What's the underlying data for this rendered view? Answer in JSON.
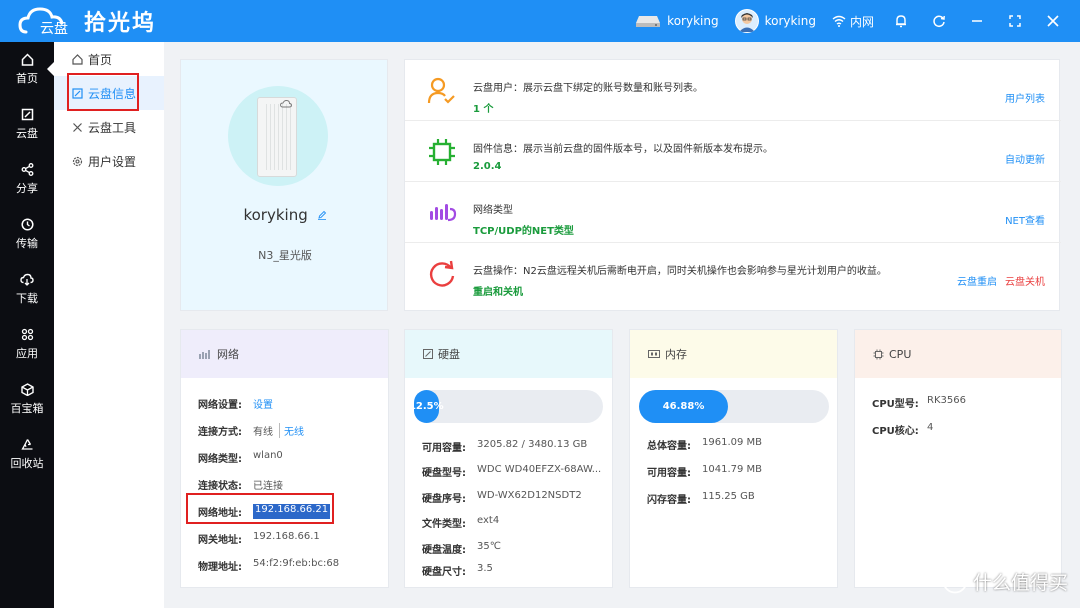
{
  "app": {
    "title": "拾光坞"
  },
  "topbar": {
    "device_name": "koryking",
    "user_name": "koryking",
    "network_label": "内网"
  },
  "leftnav": {
    "items": [
      "首页",
      "云盘",
      "分享",
      "传输",
      "下载",
      "应用",
      "百宝箱",
      "回收站"
    ]
  },
  "subnav": {
    "items": [
      "首页",
      "云盘信息",
      "云盘工具",
      "用户设置"
    ]
  },
  "profile": {
    "username": "koryking",
    "model": "N3_星光版"
  },
  "info": {
    "user": {
      "desc": "云盘用户：展示云盘下绑定的账号数量和账号列表。",
      "value": "1 个",
      "action": "用户列表"
    },
    "firmware": {
      "desc": "固件信息：展示当前云盘的固件版本号，以及固件新版本发布提示。",
      "value": "2.0.4",
      "action": "自动更新"
    },
    "net": {
      "desc": "网络类型",
      "value": "TCP/UDP的NET类型",
      "action": "NET查看"
    },
    "ops": {
      "desc": "云盘操作：N2云盘远程关机后需断电开启，同时关机操作也会影响参与星光计划用户的收益。",
      "value": "重启和关机",
      "action_restart": "云盘重启",
      "action_shutdown": "云盘关机"
    }
  },
  "network": {
    "title": "网络",
    "rows": [
      {
        "k": "网络设置:",
        "v": "设置"
      },
      {
        "k": "连接方式:",
        "v": "有线",
        "v2": "无线"
      },
      {
        "k": "网络类型:",
        "v": "wlan0"
      },
      {
        "k": "连接状态:",
        "v": "已连接"
      },
      {
        "k": "网络地址:",
        "v": "192.168.66.21"
      },
      {
        "k": "网关地址:",
        "v": "192.168.66.1"
      },
      {
        "k": "物理地址:",
        "v": "54:f2:9f:eb:bc:68"
      }
    ]
  },
  "disk": {
    "title": "硬盘",
    "usage_label": "12.5%",
    "usage_percent": 12.5,
    "rows": [
      {
        "k": "可用容量:",
        "v": "3205.82 / 3480.13 GB"
      },
      {
        "k": "硬盘型号:",
        "v": "WDC WD40EFZX-68AW..."
      },
      {
        "k": "硬盘序号:",
        "v": "WD-WX62D12NSDT2"
      },
      {
        "k": "文件类型:",
        "v": "ext4"
      },
      {
        "k": "硬盘温度:",
        "v": "35℃"
      },
      {
        "k": "硬盘尺寸:",
        "v": "3.5"
      }
    ]
  },
  "memory": {
    "title": "内存",
    "usage_label": "46.88%",
    "usage_percent": 46.88,
    "rows": [
      {
        "k": "总体容量:",
        "v": "1961.09 MB"
      },
      {
        "k": "可用容量:",
        "v": "1041.79 MB"
      },
      {
        "k": "闪存容量:",
        "v": "115.25 GB"
      }
    ]
  },
  "cpu": {
    "title": "CPU",
    "rows": [
      {
        "k": "CPU型号:",
        "v": "RK3566"
      },
      {
        "k": "CPU核心:",
        "v": "4"
      }
    ]
  },
  "watermark": {
    "text": "什么值得买"
  },
  "colors": {
    "accent": "#1f8ff5",
    "nav_bg": "#0c0d12",
    "success": "#1a9b3c",
    "danger": "#e02020",
    "network_head": "#efedfb",
    "disk_head": "#e7f8fb",
    "memory_head": "#fdfbe9",
    "cpu_head": "#fcf0ea"
  }
}
